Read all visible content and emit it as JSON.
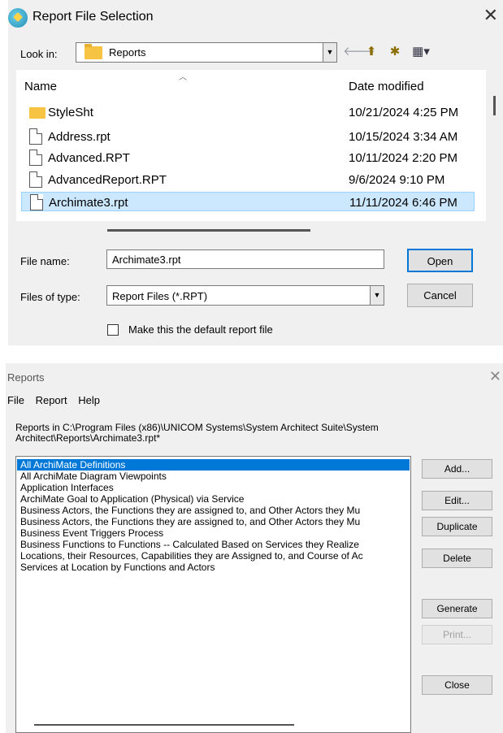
{
  "file_dialog": {
    "title": "Report File Selection",
    "close_glyph": "✕",
    "look_in_label": "Look in:",
    "look_in_value": "Reports",
    "columns": {
      "name": "Name",
      "date": "Date modified"
    },
    "files": [
      {
        "name": "StyleSht",
        "date": "10/21/2024 4:25 PM",
        "type": "folder"
      },
      {
        "name": "Address.rpt",
        "date": "10/15/2024 3:34 AM",
        "type": "file"
      },
      {
        "name": "Advanced.RPT",
        "date": "10/11/2024 2:20 PM",
        "type": "file"
      },
      {
        "name": "AdvancedReport.RPT",
        "date": "9/6/2024 9:10 PM",
        "type": "file"
      },
      {
        "name": "Archimate3.rpt",
        "date": "11/11/2024 6:46 PM",
        "type": "file",
        "selected": true
      }
    ],
    "file_name_label": "File name:",
    "file_name_value": "Archimate3.rpt",
    "files_of_type_label": "Files of type:",
    "files_of_type_value": "Report Files (*.RPT)",
    "open_label": "Open",
    "cancel_label": "Cancel",
    "default_checkbox_label": "Make this the default report file",
    "default_checked": false,
    "icons": [
      "app-icon",
      "folder-icon",
      "back-arrow-icon",
      "up-folder-icon",
      "new-folder-icon",
      "view-menu-icon",
      "file-icon"
    ]
  },
  "reports_dialog": {
    "title": "Reports",
    "close_glyph": "✕",
    "menu": [
      "File",
      "Report",
      "Help"
    ],
    "path_text": "Reports in C:\\Program Files (x86)\\UNICOM Systems\\System Architect Suite\\System Architect\\Reports\\Archimate3.rpt*",
    "reports": [
      "All ArchiMate Definitions",
      "All ArchiMate Diagram Viewpoints",
      "Application Interfaces",
      "ArchiMate Goal to Application (Physical) via Service",
      "Business Actors, the Functions they are assigned to, and Other Actors they Mu",
      "Business Actors, the Functions they are assigned to, and Other Actors they Mu",
      "Business Event Triggers Process",
      "Business Functions to Functions -- Calculated Based on Services they Realize",
      "Locations, their Resources, Capabilities they are Assigned to, and Course of Ac",
      "Services at Location by Functions and Actors"
    ],
    "selected_index": 0,
    "buttons": {
      "add": "Add...",
      "edit": "Edit...",
      "duplicate": "Duplicate",
      "delete": "Delete",
      "generate": "Generate",
      "print": "Print...",
      "close": "Close"
    }
  },
  "colors": {
    "selection_light": "#cce8ff",
    "selection_strong": "#0078d7",
    "dialog_bg": "#f0f0f0"
  }
}
